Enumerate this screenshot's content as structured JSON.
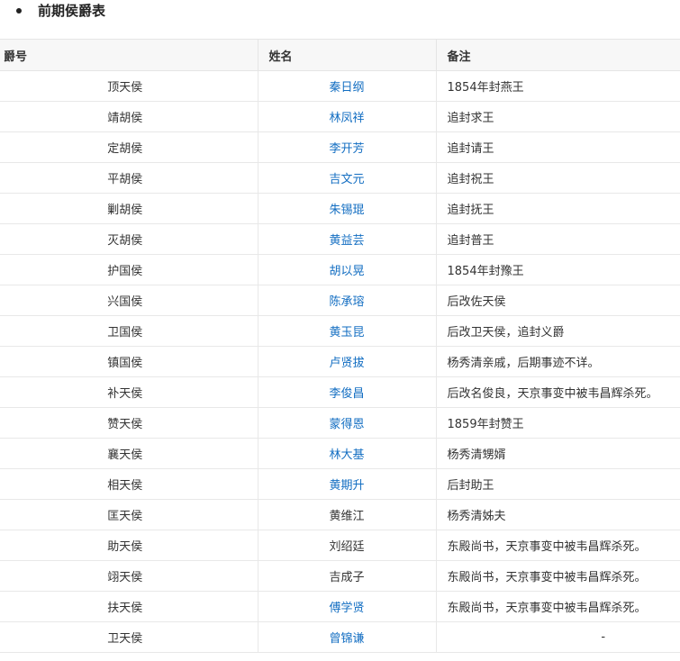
{
  "heading": {
    "title": "前期侯爵表"
  },
  "table": {
    "headers": [
      "爵号",
      "姓名",
      "备注"
    ],
    "rows": [
      {
        "title": "顶天侯",
        "name": "秦日纲",
        "name_linked": true,
        "note": "1854年封燕王"
      },
      {
        "title": "靖胡侯",
        "name": "林凤祥",
        "name_linked": true,
        "note": "追封求王"
      },
      {
        "title": "定胡侯",
        "name": "李开芳",
        "name_linked": true,
        "note": "追封请王"
      },
      {
        "title": "平胡侯",
        "name": "吉文元",
        "name_linked": true,
        "note": "追封祝王"
      },
      {
        "title": "剿胡侯",
        "name": "朱锡琨",
        "name_linked": true,
        "note": "追封抚王"
      },
      {
        "title": "灭胡侯",
        "name": "黄益芸",
        "name_linked": true,
        "note": "追封普王"
      },
      {
        "title": "护国侯",
        "name": "胡以晃",
        "name_linked": true,
        "note": "1854年封豫王"
      },
      {
        "title": "兴国侯",
        "name": "陈承瑢",
        "name_linked": true,
        "note": "后改佐天侯"
      },
      {
        "title": "卫国侯",
        "name": "黄玉昆",
        "name_linked": true,
        "note": "后改卫天侯，追封义爵"
      },
      {
        "title": "镇国侯",
        "name": "卢贤拔",
        "name_linked": true,
        "note": "杨秀清亲戚，后期事迹不详。"
      },
      {
        "title": "补天侯",
        "name": "李俊昌",
        "name_linked": true,
        "note": "后改名俊良，天京事变中被韦昌辉杀死。"
      },
      {
        "title": "赞天侯",
        "name": "蒙得恩",
        "name_linked": true,
        "note": "1859年封赞王"
      },
      {
        "title": "襄天侯",
        "name": "林大基",
        "name_linked": true,
        "note": "杨秀清甥婿"
      },
      {
        "title": "相天侯",
        "name": "黄期升",
        "name_linked": true,
        "note": "后封助王"
      },
      {
        "title": "匡天侯",
        "name": "黄维江",
        "name_linked": false,
        "note": "杨秀清姊夫"
      },
      {
        "title": "助天侯",
        "name": "刘绍廷",
        "name_linked": false,
        "note": "东殿尚书，天京事变中被韦昌辉杀死。"
      },
      {
        "title": "翊天侯",
        "name": "吉成子",
        "name_linked": false,
        "note": "东殿尚书，天京事变中被韦昌辉杀死。"
      },
      {
        "title": "扶天侯",
        "name": "傅学贤",
        "name_linked": true,
        "note": "东殿尚书，天京事变中被韦昌辉杀死。"
      },
      {
        "title": "卫天侯",
        "name": "曾锦谦",
        "name_linked": true,
        "note": "-"
      }
    ]
  }
}
